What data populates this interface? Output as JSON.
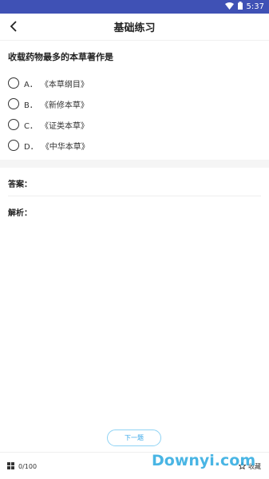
{
  "status_bar": {
    "time": "5:37"
  },
  "app_bar": {
    "title": "基础练习"
  },
  "question": {
    "text": "收载药物最多的本草著作是"
  },
  "options": [
    {
      "letter": "A．",
      "text": "《本草纲目》"
    },
    {
      "letter": "B．",
      "text": "《新修本草》"
    },
    {
      "letter": "C．",
      "text": "《证类本草》"
    },
    {
      "letter": "D．",
      "text": "《中华本草》"
    }
  ],
  "answer": {
    "label": "答案："
  },
  "analysis": {
    "label": "解析："
  },
  "next_button": {
    "label": "下一题"
  },
  "bottom_bar": {
    "progress": "0/100",
    "collect_label": "收藏"
  },
  "watermark": {
    "text": "Downyi.com"
  },
  "colors": {
    "status_bar": "#3f51b5",
    "accent": "#35a6e8",
    "next_border": "#8fd3f4"
  }
}
